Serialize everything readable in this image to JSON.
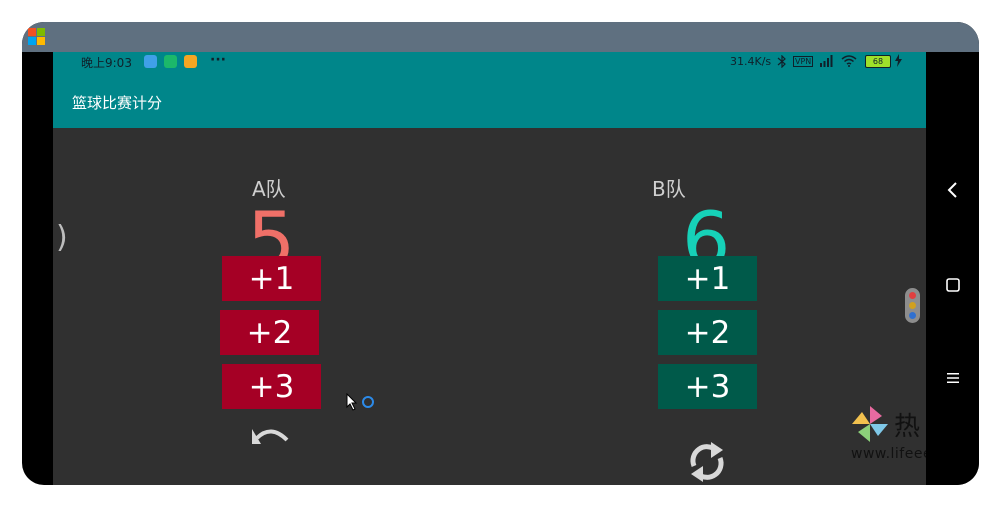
{
  "status_bar": {
    "time": "晚上9:03",
    "more_dots": "···",
    "net_speed": "31.4K/s",
    "vpn": "VPN",
    "battery": "68"
  },
  "app_bar": {
    "title": "篮球比赛计分"
  },
  "team_a": {
    "label": "A队",
    "score": "5",
    "score_color": "#f07068",
    "button_color": "#a50025",
    "buttons": [
      "+1",
      "+2",
      "+3"
    ],
    "undo_icon": "undo-icon"
  },
  "team_b": {
    "label": "B队",
    "score": "6",
    "score_color": "#16d1b8",
    "button_color": "#005a4a",
    "buttons": [
      "+1",
      "+2",
      "+3"
    ],
    "reset_icon": "refresh-icon"
  },
  "watermark": {
    "char": "热",
    "url": "www.lifeee"
  },
  "nav_bar": {
    "back_icon": "back-icon",
    "home_icon": "home-icon",
    "menu_icon": "menu-icon"
  },
  "colors": {
    "app_bar": "#00868a",
    "background": "#303030"
  }
}
